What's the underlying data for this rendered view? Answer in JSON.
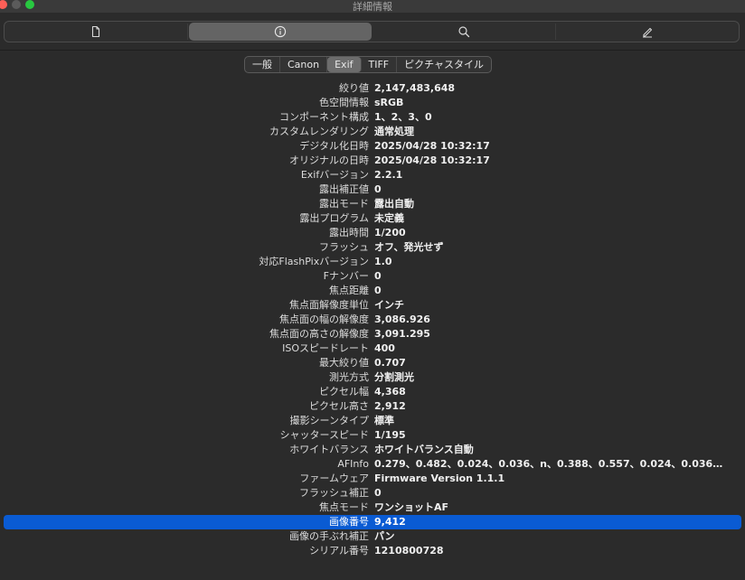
{
  "window": {
    "title": "詳細情報"
  },
  "toolbar": {
    "active_index": 1,
    "items": [
      "document-icon",
      "info-icon",
      "search-icon",
      "pencil-icon"
    ]
  },
  "tabs": {
    "active": "Exif",
    "items": [
      "一般",
      "Canon",
      "Exif",
      "TIFF",
      "ピクチャスタイル"
    ]
  },
  "exif_rows": [
    {
      "key": "絞り値",
      "value": "2,147,483,648"
    },
    {
      "key": "色空間情報",
      "value": "sRGB"
    },
    {
      "key": "コンポーネント構成",
      "value": "1、2、3、0"
    },
    {
      "key": "カスタムレンダリング",
      "value": "通常処理"
    },
    {
      "key": "デジタル化日時",
      "value": "2025/04/28 10:32:17"
    },
    {
      "key": "オリジナルの日時",
      "value": "2025/04/28 10:32:17"
    },
    {
      "key": "Exifバージョン",
      "value": "2.2.1"
    },
    {
      "key": "露出補正値",
      "value": "0"
    },
    {
      "key": "露出モード",
      "value": "露出自動"
    },
    {
      "key": "露出プログラム",
      "value": "未定義"
    },
    {
      "key": "露出時間",
      "value": "1/200"
    },
    {
      "key": "フラッシュ",
      "value": "オフ、発光せず"
    },
    {
      "key": "対応FlashPixバージョン",
      "value": "1.0"
    },
    {
      "key": "Fナンバー",
      "value": "0"
    },
    {
      "key": "焦点距離",
      "value": "0"
    },
    {
      "key": "焦点面解像度単位",
      "value": "インチ"
    },
    {
      "key": "焦点面の幅の解像度",
      "value": "3,086.926"
    },
    {
      "key": "焦点面の高さの解像度",
      "value": "3,091.295"
    },
    {
      "key": "ISOスピードレート",
      "value": "400"
    },
    {
      "key": "最大絞り値",
      "value": "0.707"
    },
    {
      "key": "測光方式",
      "value": "分割測光"
    },
    {
      "key": "ピクセル幅",
      "value": "4,368"
    },
    {
      "key": "ピクセル高さ",
      "value": "2,912"
    },
    {
      "key": "撮影シーンタイプ",
      "value": "標準"
    },
    {
      "key": "シャッタースピード",
      "value": "1/195"
    },
    {
      "key": "ホワイトバランス",
      "value": "ホワイトバランス自動"
    },
    {
      "key": "AFInfo",
      "value": "0.279、0.482、0.024、0.036、n、0.388、0.557、0.024、0.036、n、0...."
    },
    {
      "key": "ファームウェア",
      "value": "Firmware Version 1.1.1"
    },
    {
      "key": "フラッシュ補正",
      "value": "0"
    },
    {
      "key": "焦点モード",
      "value": "ワンショットAF"
    },
    {
      "key": "画像番号",
      "value": "9,412",
      "selected": true
    },
    {
      "key": "画像の手ぶれ補正",
      "value": "パン"
    },
    {
      "key": "シリアル番号",
      "value": "1210800728"
    }
  ]
}
